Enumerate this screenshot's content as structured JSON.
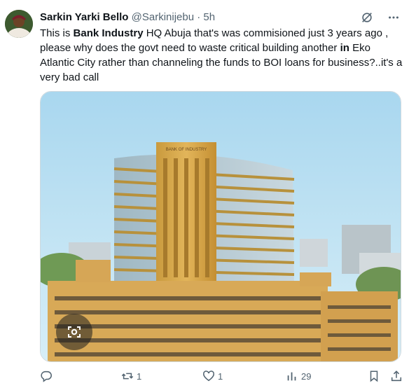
{
  "tweet": {
    "author_name": "Sarkin Yarki Bello",
    "handle": "@Sarkinijebu",
    "separator": "·",
    "time": "5h",
    "text_parts": [
      "This is ",
      "Bank Industry",
      " HQ Abuja that's was commisioned just 3 years ago , please why does the govt need to waste critical building another ",
      "in",
      " Eko Atlantic City  rather than channeling the funds to BOI loans for business?..it's a very bad call"
    ]
  },
  "image": {
    "sign_text": "BANK OF INDUSTRY"
  },
  "actions": {
    "reply_count": "",
    "retweet_count": "1",
    "like_count": "1",
    "views_count": "29"
  },
  "icons": {
    "grok": "grok-icon",
    "more": "more-icon",
    "lens": "lens-icon",
    "reply": "reply-icon",
    "retweet": "retweet-icon",
    "like": "heart-icon",
    "views": "views-icon",
    "bookmark": "bookmark-icon",
    "share": "share-icon"
  },
  "colors": {
    "text": "#0f1419",
    "secondary": "#536471",
    "border": "#cfd9de"
  }
}
